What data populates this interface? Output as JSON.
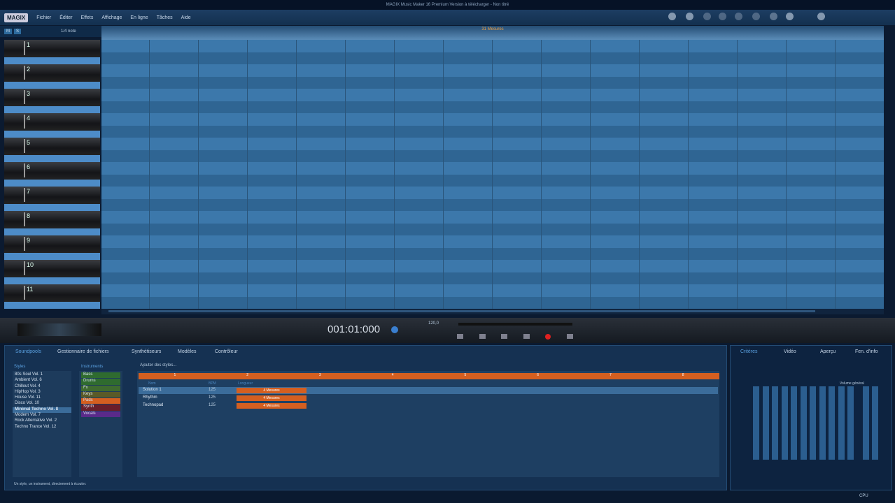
{
  "window": {
    "title": "MAGIX Music Maker 16 Premium Version à télécharger - Non titré"
  },
  "menu": {
    "logo": "MAGIX",
    "items": [
      "Fichier",
      "Éditer",
      "Effets",
      "Affichage",
      "En ligne",
      "Tâches",
      "Aide"
    ]
  },
  "tracks": {
    "toolbar_left": [
      "M",
      "S"
    ],
    "quantize": "1/4 note",
    "items": [
      "1",
      "2",
      "3",
      "4",
      "5",
      "6",
      "7",
      "8",
      "9",
      "10",
      "11"
    ]
  },
  "ruler": {
    "label": "31 Mesures"
  },
  "transport": {
    "time": "001:01:000",
    "tempo": "120,0"
  },
  "lower": {
    "tabs": [
      "Soundpools",
      "Gestionnaire de fichiers",
      "Synthétiseurs",
      "Modèles",
      "Contrôleur"
    ],
    "styles_header": "Styles",
    "styles": [
      "80s Soul Vol. 1",
      "Ambient Vol. 6",
      "Chillout Vol. 4",
      "HipHop Vol. 3",
      "House Vol. 11",
      "Disco Vol. 10",
      "Minimal Techno Vol. 8",
      "Modern Vol. 7",
      "Rock Alternative Vol. 2",
      "Techno Trance Vol. 12"
    ],
    "styles_selected": 6,
    "instruments_header": "Instruments",
    "instruments": [
      {
        "label": "Bass",
        "color": "#2f6b2f"
      },
      {
        "label": "Drums",
        "color": "#2f6b2f"
      },
      {
        "label": "Fx",
        "color": "#3f6b2f"
      },
      {
        "label": "Keys",
        "color": "#5a5a28"
      },
      {
        "label": "Pads",
        "color": "#d45f20"
      },
      {
        "label": "Synth",
        "color": "#6a1e2a"
      },
      {
        "label": "Vocals",
        "color": "#5a2a8a"
      }
    ],
    "instruments_selected": 4,
    "add_styles": "Ajouter des styles...",
    "columns": [
      "Nom",
      "BPM",
      "Longueur"
    ],
    "files": [
      {
        "name": "Solution 1",
        "bpm": "125",
        "len": "4 Mesures"
      },
      {
        "name": "Rhythm",
        "bpm": "125",
        "len": "4 Mesures"
      },
      {
        "name": "Technopad",
        "bpm": "125",
        "len": "4 Mesures"
      }
    ],
    "scale": [
      "1",
      "2",
      "3",
      "4",
      "5",
      "6",
      "7",
      "8"
    ],
    "hint": "Un style, un instrument, directement à écouter."
  },
  "right": {
    "tabs": [
      "Critères",
      "Vidéo",
      "Aperçu",
      "Fen. d'info"
    ],
    "legend": "Volume général"
  },
  "status": {
    "cpu": "CPU"
  }
}
